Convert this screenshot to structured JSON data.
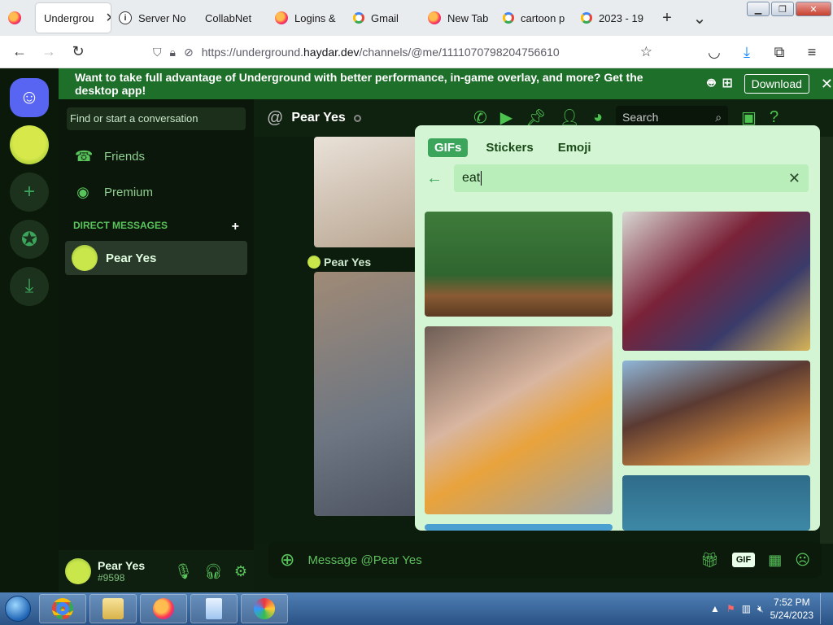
{
  "browser": {
    "tabs": [
      {
        "label": "",
        "icon": "firefox-icon"
      },
      {
        "label": "Undergrou",
        "active": true
      },
      {
        "label": "Server No",
        "icon": "info-icon"
      },
      {
        "label": "CollabNet"
      },
      {
        "label": "Logins &",
        "icon": "firefox-icon"
      },
      {
        "label": "Gmail",
        "icon": "google-icon"
      },
      {
        "label": "New Tab",
        "icon": "firefox-icon"
      },
      {
        "label": "cartoon p",
        "icon": "google-icon"
      },
      {
        "label": "2023 - 19",
        "icon": "google-icon"
      }
    ],
    "url_prefix": "https://underground.",
    "url_host": "haydar.dev",
    "url_path": "/channels/@me/1111070798204756610"
  },
  "banner": {
    "text": "Want to take full advantage of Underground with better performance, in-game overlay, and more? Get the desktop app!",
    "download_label": "Download"
  },
  "dm": {
    "search_placeholder": "Find or start a conversation",
    "friends": "Friends",
    "premium": "Premium",
    "section": "DIRECT MESSAGES",
    "user": "Pear Yes"
  },
  "user_panel": {
    "name": "Pear Yes",
    "tag": "#9598"
  },
  "chat": {
    "title": "Pear Yes",
    "search_label": "Search",
    "message_author": "Pear Yes",
    "input_placeholder": "Message @Pear Yes",
    "gif_label": "GIF"
  },
  "picker": {
    "tabs": [
      "GIFs",
      "Stickers",
      "Emoji"
    ],
    "query": "eat"
  },
  "taskbar": {
    "time": "7:52 PM",
    "date": "5/24/2023"
  },
  "colors": {
    "accent": "#3ba55c",
    "banner": "#1e6f2a",
    "picker_bg": "#d3f5d3"
  }
}
